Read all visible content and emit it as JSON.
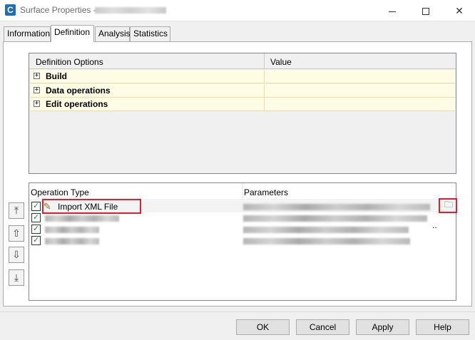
{
  "window": {
    "title": "Surface Properties -",
    "app_icon_letter": "C",
    "controls": {
      "minimize": "minimize-icon",
      "maximize": "maximize-icon",
      "close": "✕"
    }
  },
  "tabs": [
    {
      "label": "Information",
      "active": false
    },
    {
      "label": "Definition",
      "active": true
    },
    {
      "label": "Analysis",
      "active": false
    },
    {
      "label": "Statistics",
      "active": false
    }
  ],
  "definition_options": {
    "columns": [
      "Definition Options",
      "Value"
    ],
    "rows": [
      {
        "label": "Build",
        "expander": "+"
      },
      {
        "label": "Data operations",
        "expander": "+"
      },
      {
        "label": "Edit operations",
        "expander": "+"
      }
    ]
  },
  "operations": {
    "columns": [
      "Operation Type",
      "Parameters"
    ],
    "rows": [
      {
        "name": "Import XML File",
        "checked": true,
        "selected": true,
        "ellipsis": "..",
        "browse_icon": "browse-file-icon"
      },
      {
        "name": "",
        "checked": true
      },
      {
        "name": "",
        "checked": true
      },
      {
        "name": "",
        "checked": true
      }
    ],
    "check_glyph": "✓"
  },
  "side_buttons": [
    {
      "icon": "move-to-top-icon",
      "glyph": "⤒"
    },
    {
      "icon": "move-up-icon",
      "glyph": "⇧"
    },
    {
      "icon": "move-down-icon",
      "glyph": "⇩"
    },
    {
      "icon": "move-to-bottom-icon",
      "glyph": "⤓"
    }
  ],
  "footer": {
    "ok": "OK",
    "cancel": "Cancel",
    "apply": "Apply",
    "help": "Help"
  },
  "colors": {
    "highlight_red": "#d9242f",
    "option_row_bg": "#fffce6",
    "check_green": "#1a8a1a"
  }
}
